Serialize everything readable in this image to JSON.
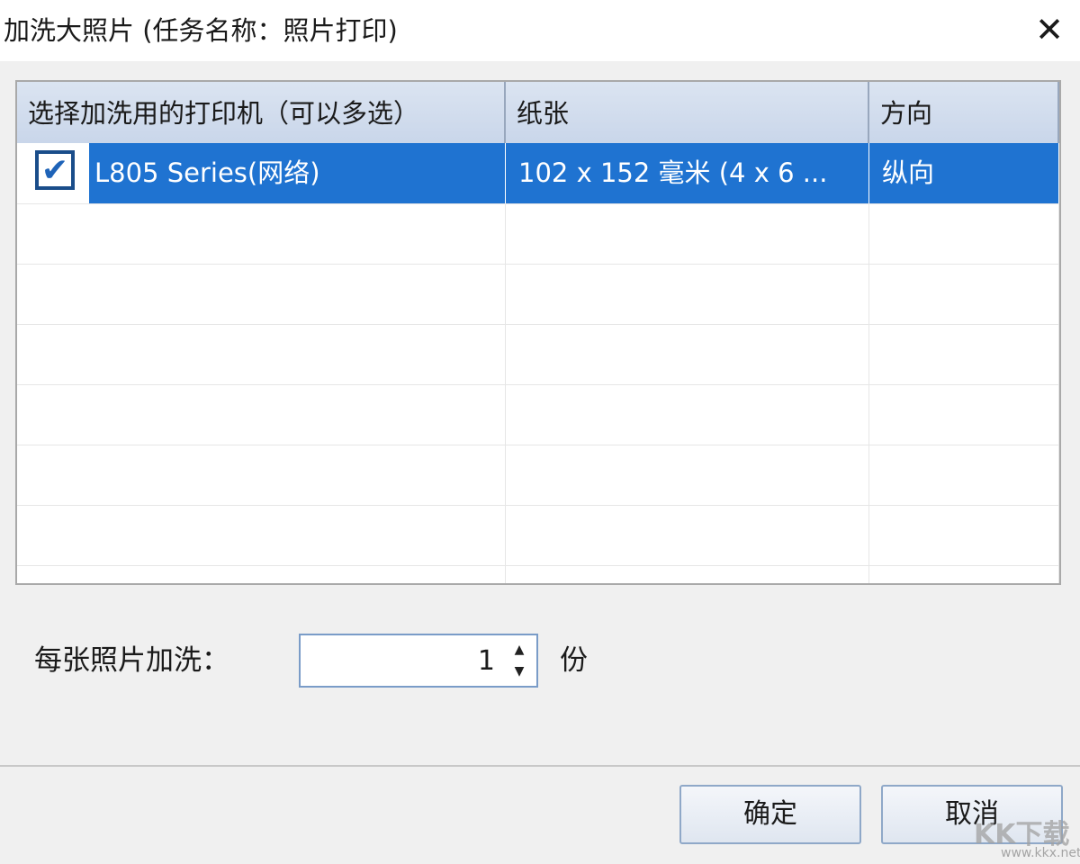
{
  "window": {
    "title": "加洗大照片 (任务名称：照片打印)",
    "close_glyph": "✕"
  },
  "grid": {
    "columns": [
      "选择加洗用的打印机（可以多选）",
      "纸张",
      "方向"
    ],
    "rows": [
      {
        "checked": true,
        "check_glyph": "✔",
        "printer": "L805 Series(网络)",
        "paper": "102 x 152 毫米 (4 x 6 ...",
        "orientation": "纵向"
      }
    ]
  },
  "copies": {
    "label": "每张照片加洗：",
    "value": "1",
    "up_glyph": "▲",
    "down_glyph": "▼",
    "unit": "份"
  },
  "buttons": {
    "ok": "确定",
    "cancel": "取消"
  },
  "watermark": {
    "text": "KK下载",
    "url": "www.kkx.net"
  },
  "colors": {
    "selection": "#1f73d1",
    "header": "#d3deee",
    "background": "#f0f0f0"
  }
}
